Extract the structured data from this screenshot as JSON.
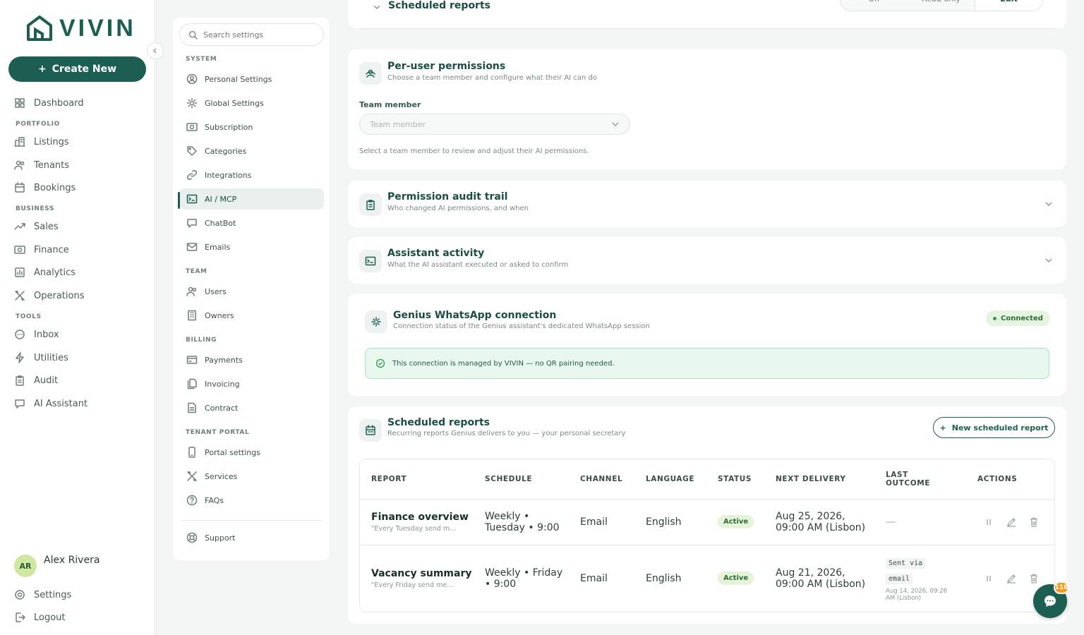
{
  "brand": {
    "name": "VIVIN"
  },
  "leftnav": {
    "create_label": "Create New",
    "dashboard": "Dashboard",
    "group_portfolio": "PORTFOLIO",
    "listings": "Listings",
    "tenants": "Tenants",
    "bookings": "Bookings",
    "group_business": "BUSINESS",
    "sales": "Sales",
    "finance": "Finance",
    "analytics": "Analytics",
    "operations": "Operations",
    "group_tools": "TOOLS",
    "inbox": "Inbox",
    "utilities": "Utilities",
    "audit": "Audit",
    "ai_assistant": "AI Assistant",
    "user_initials": "AR",
    "user_name": "Alex Rivera",
    "settings": "Settings",
    "logout": "Logout"
  },
  "settings_nav": {
    "search_placeholder": "Search settings",
    "group_system": "SYSTEM",
    "personal": "Personal Settings",
    "global": "Global Settings",
    "subscription": "Subscription",
    "categories": "Categories",
    "integrations": "Integrations",
    "ai_mcp": "AI / MCP",
    "chatbot": "ChatBot",
    "emails": "Emails",
    "group_team": "TEAM",
    "users": "Users",
    "owners": "Owners",
    "group_billing": "BILLING",
    "payments": "Payments",
    "invoicing": "Invoicing",
    "contract": "Contract",
    "group_tenant": "TENANT PORTAL",
    "portal_settings": "Portal settings",
    "services": "Services",
    "faqs": "FAQs",
    "support": "Support"
  },
  "top_card": {
    "title": "Scheduled reports",
    "seg_off": "Off",
    "seg_read": "Read-only",
    "seg_edit": "Edit"
  },
  "per_user": {
    "title": "Per-user permissions",
    "subtitle": "Choose a team member and configure what their AI can do",
    "field_label": "Team member",
    "select_placeholder": "Team member",
    "helper": "Select a team member to review and adjust their AI permissions."
  },
  "audit_trail": {
    "title": "Permission audit trail",
    "subtitle": "Who changed AI permissions, and when"
  },
  "assistant_activity": {
    "title": "Assistant activity",
    "subtitle": "What the AI assistant executed or asked to confirm"
  },
  "whatsapp": {
    "title": "Genius WhatsApp connection",
    "subtitle": "Connection status of the Genius assistant's dedicated WhatsApp session",
    "status": "Connected",
    "notice": "This connection is managed by VIVIN — no QR pairing needed."
  },
  "reports": {
    "title": "Scheduled reports",
    "subtitle": "Recurring reports Genius delivers to you — your personal secretary",
    "new_button": "New scheduled report",
    "columns": {
      "report": "REPORT",
      "schedule": "SCHEDULE",
      "channel": "CHANNEL",
      "language": "LANGUAGE",
      "status": "STATUS",
      "next": "NEXT DELIVERY",
      "last_1": "LAST",
      "last_2": "OUTCOME",
      "actions": "ACTIONS"
    },
    "rows": [
      {
        "name": "Finance overview",
        "desc": "\"Every Tuesday send m...",
        "schedule_1": "Weekly •",
        "schedule_2": "Tuesday • 9:00",
        "channel": "Email",
        "language": "English",
        "status": "Active",
        "next_1": "Aug 25, 2026,",
        "next_2": "09:00 AM (Lisbon)",
        "last": "—"
      },
      {
        "name": "Vacancy summary",
        "desc": "\"Every Friday send me...",
        "schedule_1": "Weekly • Friday",
        "schedule_2": "• 9:00",
        "channel": "Email",
        "language": "English",
        "status": "Active",
        "next_1": "Aug 21, 2026,",
        "next_2": "09:00 AM (Lisbon)",
        "last_1": "Sent via",
        "last_2": "email",
        "last_time_1": "Aug 14, 2026, 09:26",
        "last_time_2": "AM (Lisbon)"
      }
    ]
  },
  "chat": {
    "badge": "118"
  }
}
